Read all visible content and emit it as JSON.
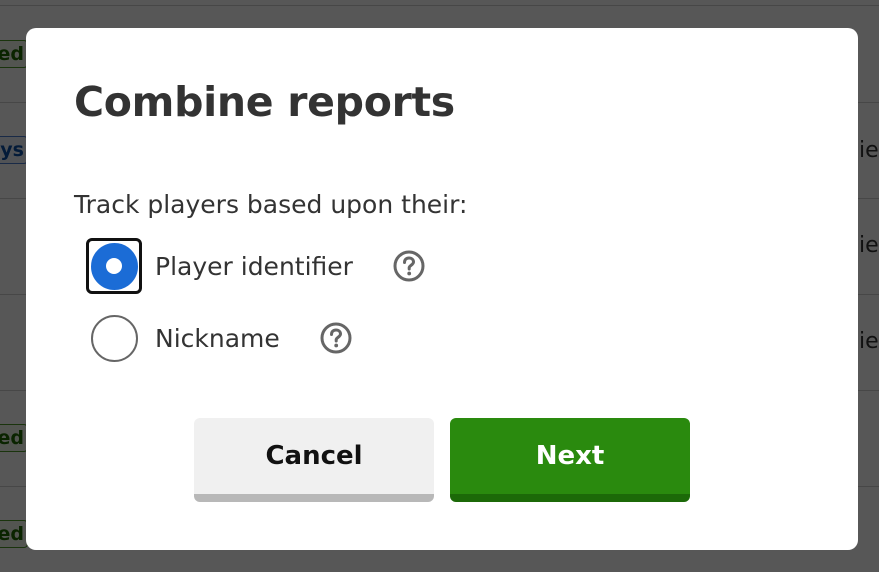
{
  "background": {
    "tags": [
      {
        "text": "ed",
        "style": "green"
      },
      {
        "text": "ys",
        "style": "blue"
      },
      {
        "text": "ed",
        "style": "green"
      },
      {
        "text": "ed",
        "style": "green"
      }
    ],
    "fragments": [
      "ie",
      "ie",
      "ie"
    ]
  },
  "dialog": {
    "title": "Combine reports",
    "prompt": "Track players based upon their:",
    "options": [
      {
        "label": "Player identifier",
        "checked": true,
        "icon": "help-circle-icon"
      },
      {
        "label": "Nickname",
        "checked": false,
        "icon": "help-circle-icon"
      }
    ],
    "cancel_label": "Cancel",
    "next_label": "Next"
  },
  "colors": {
    "accent": "#1b6cd6",
    "primary_button": "#2a8a0e",
    "secondary_button": "#f0f0f0",
    "text": "#333333"
  }
}
